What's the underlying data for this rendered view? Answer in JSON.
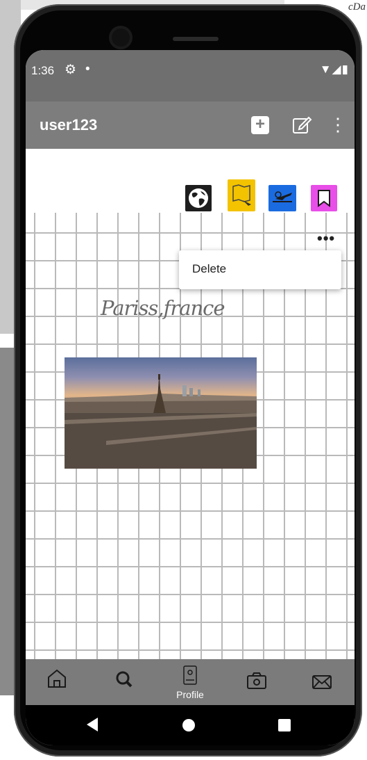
{
  "background": {
    "corner_text": "cDa"
  },
  "status_bar": {
    "time": "1:36",
    "settings_icon": "gear-icon",
    "notification_dot": "•",
    "indicators": "▼◢▮"
  },
  "app_bar": {
    "title": "user123",
    "add_icon": "add-box-icon",
    "edit_icon": "edit-icon",
    "more_icon": "more-vert-icon"
  },
  "category_icons": [
    "globe-icon",
    "map-flight-icon",
    "flight-icon",
    "bookmark-icon"
  ],
  "post": {
    "title": "Pariss,france",
    "image": "eiffel-tower-paris-photo",
    "menu_trigger": "•••",
    "menu_items": [
      "Delete"
    ]
  },
  "bottom_nav": [
    {
      "icon": "home-icon",
      "label": ""
    },
    {
      "icon": "search-icon",
      "label": ""
    },
    {
      "icon": "profile-icon",
      "label": "Profile"
    },
    {
      "icon": "camera-icon",
      "label": ""
    },
    {
      "icon": "mail-icon",
      "label": ""
    }
  ],
  "system_nav": [
    "back",
    "home",
    "recents"
  ],
  "colors": {
    "status_bar": "#6f6f6f",
    "app_bar": "#7d7d7d",
    "bottom_nav": "#7b7b7b",
    "grid_line": "#b9b9b9"
  }
}
